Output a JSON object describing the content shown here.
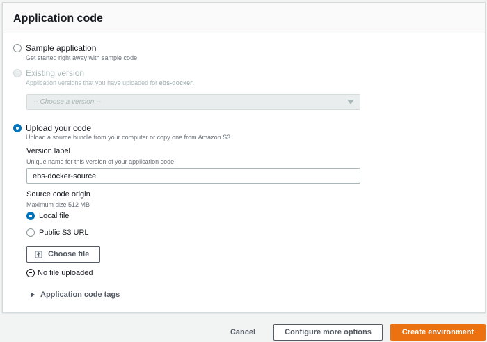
{
  "panel": {
    "title": "Application code"
  },
  "options": {
    "sample": {
      "label": "Sample application",
      "description": "Get started right away with sample code."
    },
    "existing": {
      "label": "Existing version",
      "description_prefix": "Application versions that you have uploaded for ",
      "description_app": "ebs-docker",
      "description_suffix": ".",
      "select_placeholder": "-- Choose a version --"
    },
    "upload": {
      "label": "Upload your code",
      "description": "Upload a source bundle from your computer or copy one from Amazon S3."
    }
  },
  "version_label": {
    "label": "Version label",
    "description": "Unique name for this version of your application code.",
    "value": "ebs-docker-source"
  },
  "source_origin": {
    "label": "Source code origin",
    "description": "Maximum size 512 MB",
    "local_file": "Local file",
    "public_s3": "Public S3 URL",
    "choose_file": "Choose file",
    "no_file": "No file uploaded"
  },
  "tags": {
    "label": "Application code tags"
  },
  "footer": {
    "cancel": "Cancel",
    "configure": "Configure more options",
    "create": "Create environment"
  },
  "colors": {
    "accent": "#0073bb",
    "primary_button": "#ec7211",
    "disabled": "#aab7b8"
  },
  "icons": {
    "upload": "upload-icon",
    "no_file": "minus-circle-icon",
    "expand": "caret-right-icon",
    "select": "caret-down-icon"
  }
}
